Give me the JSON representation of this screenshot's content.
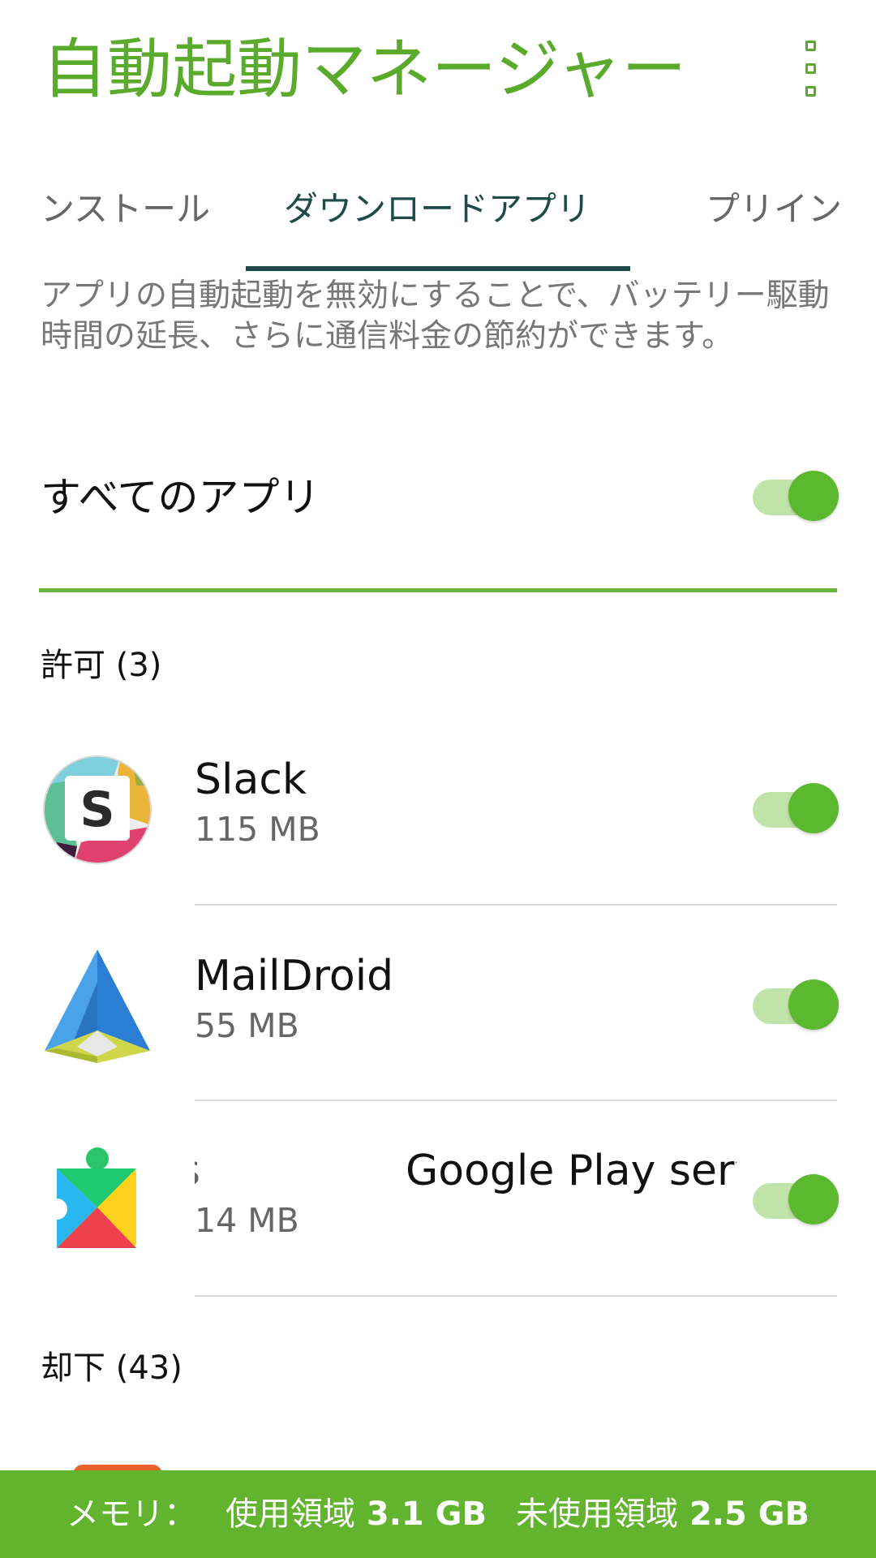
{
  "header": {
    "title": "自動起動マネージャー",
    "menu_icon": "overflow-menu-icon"
  },
  "tabs": [
    {
      "label": "インストール",
      "visible_fragment": "ンストール",
      "active": false
    },
    {
      "label": "ダウンロードアプリ",
      "active": true
    },
    {
      "label": "プリイン",
      "visible_fragment": "プリイン",
      "active": false
    }
  ],
  "description": "アプリの自動起動を無効にすることで、バッテリー駆動時間の延長、さらに通信料金の節約ができます。",
  "all_apps": {
    "label": "すべてのアプリ",
    "enabled": true
  },
  "allowed_section": {
    "header": "許可 (3)",
    "apps": [
      {
        "name": "Slack",
        "size": "115 MB",
        "enabled": true,
        "icon": "slack-icon"
      },
      {
        "name": "MailDroid",
        "size": "55 MB",
        "enabled": true,
        "icon": "maildroid-icon"
      },
      {
        "name": "Google Play services",
        "name_tail_fragment": "s",
        "name_visible_fragment": "Google Play servi",
        "size": "14 MB",
        "enabled": true,
        "icon": "google-play-services-icon"
      }
    ]
  },
  "denied_section": {
    "header": "却下 (43)"
  },
  "memory_bar": {
    "label": "メモリ：",
    "used_label": "使用領域",
    "used_value": "3.1 GB",
    "free_label": "未使用領域",
    "free_value": "2.5 GB"
  },
  "colors": {
    "accent": "#5aaa2c",
    "tab_active": "#1e4b47",
    "switch_thumb": "#5cb82e",
    "switch_track": "#bfe3a8",
    "bottom_bar": "#62b32e"
  }
}
